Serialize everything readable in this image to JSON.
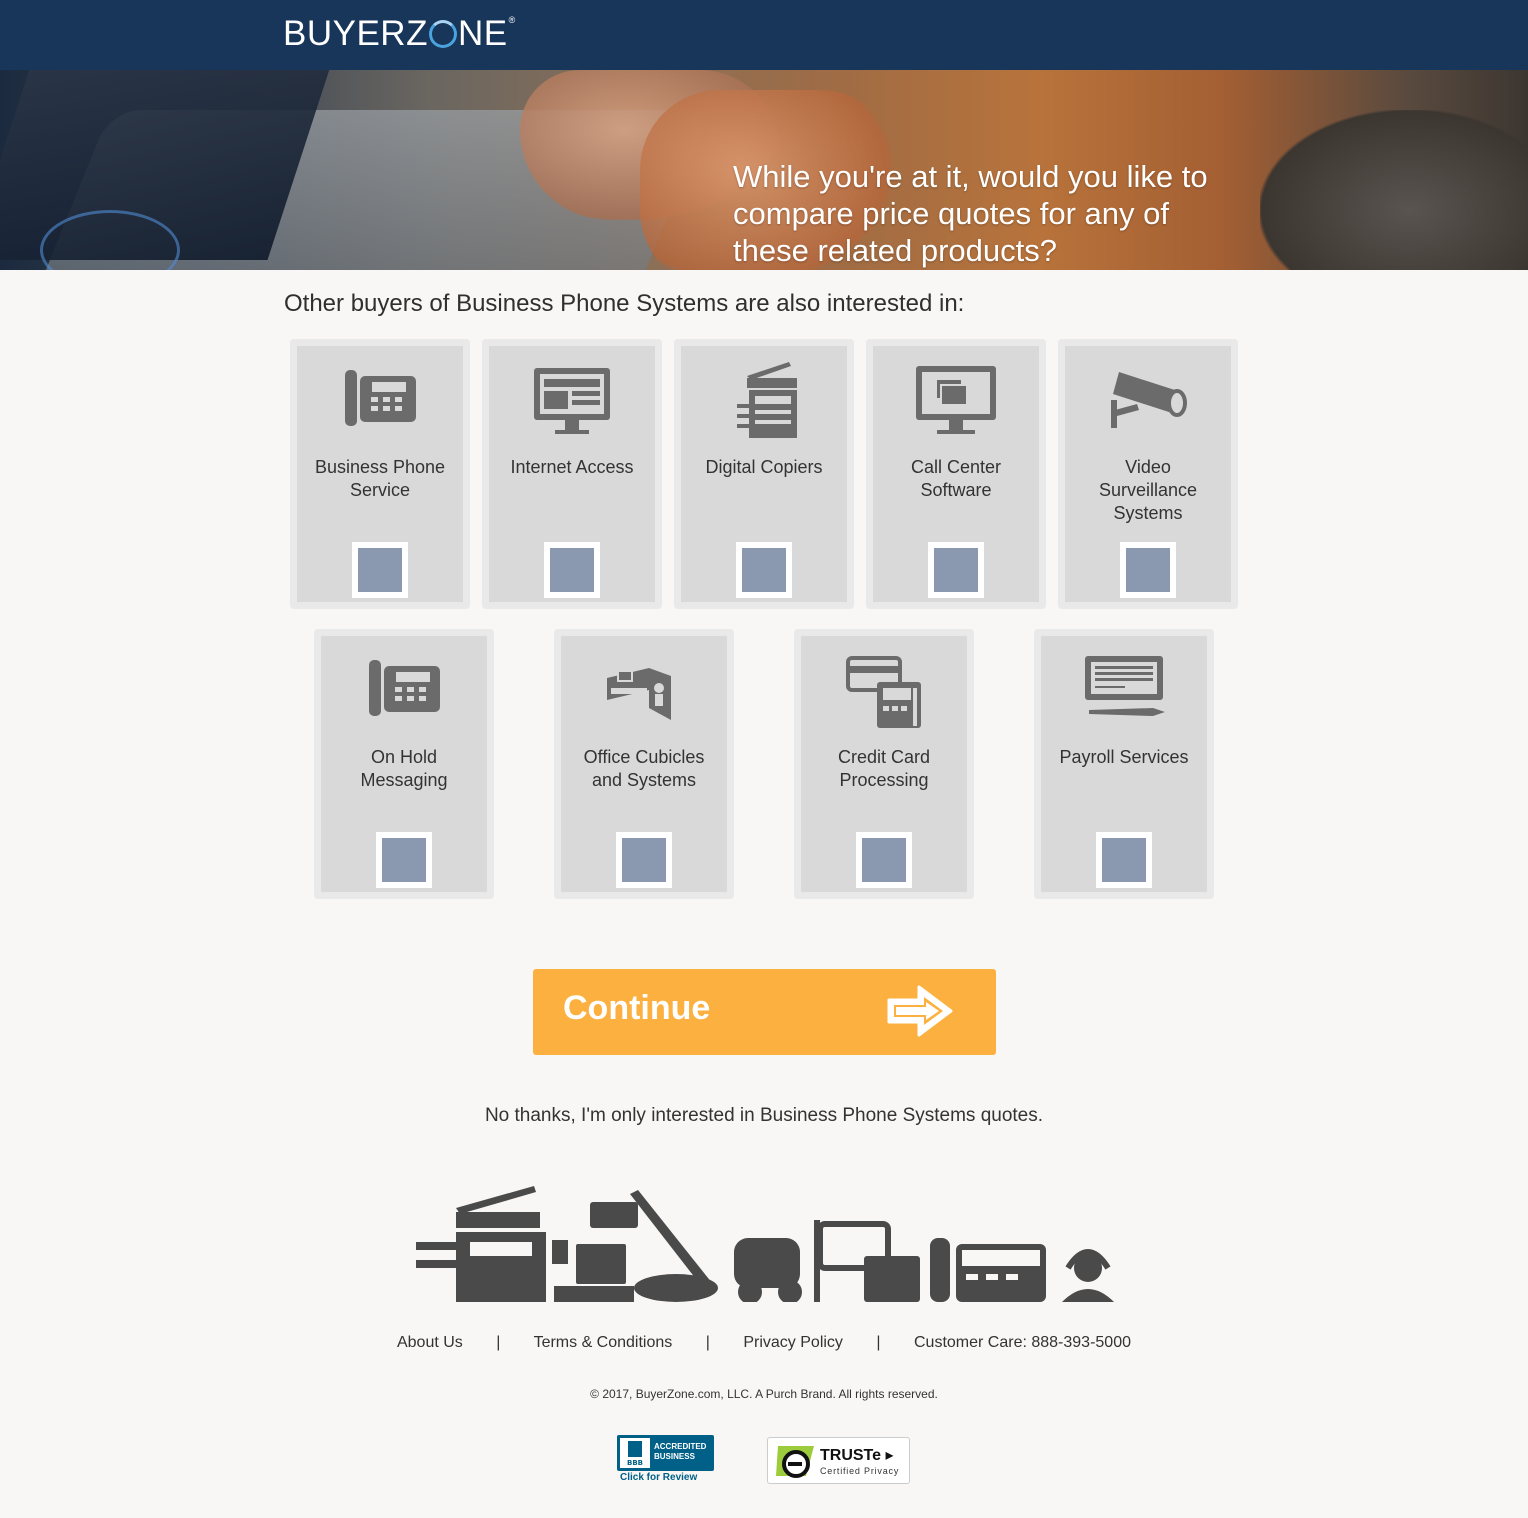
{
  "header": {
    "logo_text": "BUYERZ",
    "logo_text_end": "NE",
    "logo_mark": "®"
  },
  "hero": {
    "title": "While you're at it, would you like to compare price quotes for any of these related products?"
  },
  "section": {
    "title": "Other buyers of Business Phone Systems are also interested in:"
  },
  "products": [
    {
      "label": "Business Phone Service",
      "icon": "desk-phone-icon",
      "checked": false
    },
    {
      "label": "Internet Access",
      "icon": "monitor-icon",
      "checked": false
    },
    {
      "label": "Digital Copiers",
      "icon": "copier-icon",
      "checked": false
    },
    {
      "label": "Call Center Software",
      "icon": "monitor-folder-icon",
      "checked": false
    },
    {
      "label": "Video Surveillance Systems",
      "icon": "security-camera-icon",
      "checked": false
    },
    {
      "label": "On Hold Messaging",
      "icon": "desk-phone-icon",
      "checked": false
    },
    {
      "label": "Office Cubicles and Systems",
      "icon": "cubicle-icon",
      "checked": false
    },
    {
      "label": "Credit Card Processing",
      "icon": "card-terminal-icon",
      "checked": false
    },
    {
      "label": "Payroll Services",
      "icon": "check-pen-icon",
      "checked": false
    }
  ],
  "continue_button": {
    "label": "Continue",
    "color": "#fbb040"
  },
  "no_thanks": "No thanks, I'm only interested in Business Phone Systems quotes.",
  "footer": {
    "links": [
      "About Us",
      "Terms & Conditions",
      "Privacy Policy",
      "Customer Care: 888-393-5000"
    ],
    "separator": "|",
    "copyright": "© 2017, BuyerZone.com, LLC. A Purch Brand. All rights reserved."
  },
  "badges": {
    "bbb": {
      "line1": "ACCREDITED",
      "line2": "BUSINESS",
      "review": "Click for Review",
      "mark": "BBB"
    },
    "truste": {
      "name": "TRUSTe",
      "sub": "Certified Privacy"
    }
  },
  "colors": {
    "header_bg": "#17365a",
    "accent_blue": "#4aa3df",
    "checkbox": "#8a98b0",
    "card_bg": "#d9d9d9"
  }
}
